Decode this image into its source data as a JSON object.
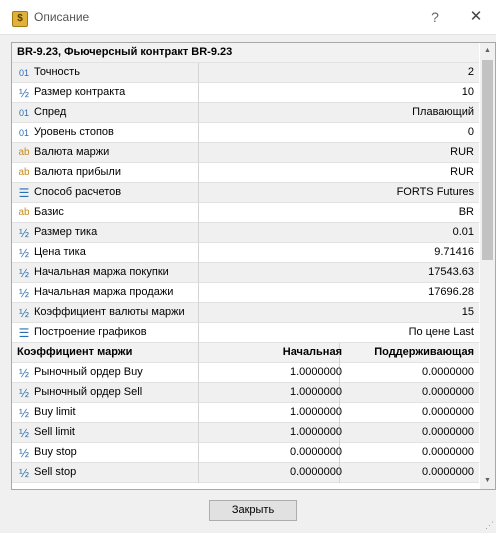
{
  "window": {
    "title": "Описание",
    "help": "?",
    "close": "✕",
    "app_icon": "$"
  },
  "symbol_header": "BR-9.23, Фьючерсный контракт BR-9.23",
  "properties": [
    {
      "icon": "int",
      "name": "Точность",
      "value": "2"
    },
    {
      "icon": "dbl",
      "name": "Размер контракта",
      "value": "10"
    },
    {
      "icon": "int",
      "name": "Спред",
      "value": "Плавающий"
    },
    {
      "icon": "int",
      "name": "Уровень стопов",
      "value": "0"
    },
    {
      "icon": "str",
      "name": "Валюта маржи",
      "value": "RUR"
    },
    {
      "icon": "str",
      "name": "Валюта прибыли",
      "value": "RUR"
    },
    {
      "icon": "enm",
      "name": "Способ расчетов",
      "value": "FORTS Futures"
    },
    {
      "icon": "str",
      "name": "Базис",
      "value": "BR"
    },
    {
      "icon": "dbl",
      "name": "Размер тика",
      "value": "0.01"
    },
    {
      "icon": "dbl",
      "name": "Цена тика",
      "value": "9.71416"
    },
    {
      "icon": "dbl",
      "name": "Начальная маржа покупки",
      "value": "17543.63"
    },
    {
      "icon": "dbl",
      "name": "Начальная маржа продажи",
      "value": "17696.28"
    },
    {
      "icon": "dbl",
      "name": "Коэффициент валюты маржи",
      "value": "15"
    },
    {
      "icon": "enm",
      "name": "Построение графиков",
      "value": "По цене Last"
    }
  ],
  "margin_section": {
    "title": "Коэффициент маржи",
    "col_initial": "Начальная",
    "col_maintenance": "Поддерживающая",
    "rows": [
      {
        "icon": "dbl",
        "name": "Рыночный ордер Buy",
        "initial": "1.0000000",
        "maintenance": "0.0000000"
      },
      {
        "icon": "dbl",
        "name": "Рыночный ордер Sell",
        "initial": "1.0000000",
        "maintenance": "0.0000000"
      },
      {
        "icon": "dbl",
        "name": "Buy limit",
        "initial": "1.0000000",
        "maintenance": "0.0000000"
      },
      {
        "icon": "dbl",
        "name": "Sell limit",
        "initial": "1.0000000",
        "maintenance": "0.0000000"
      },
      {
        "icon": "dbl",
        "name": "Buy stop",
        "initial": "0.0000000",
        "maintenance": "0.0000000"
      },
      {
        "icon": "dbl",
        "name": "Sell stop",
        "initial": "0.0000000",
        "maintenance": "0.0000000"
      }
    ]
  },
  "icons": {
    "int": {
      "glyph": "01",
      "name": "integer-icon"
    },
    "dbl": {
      "glyph": "½",
      "name": "fraction-icon"
    },
    "str": {
      "glyph": "ab",
      "name": "string-icon"
    },
    "enm": {
      "glyph": "☰",
      "name": "enum-icon"
    }
  },
  "buttons": {
    "close_label": "Закрыть"
  },
  "scrollbar": {
    "up": "▲",
    "down": "▼"
  }
}
